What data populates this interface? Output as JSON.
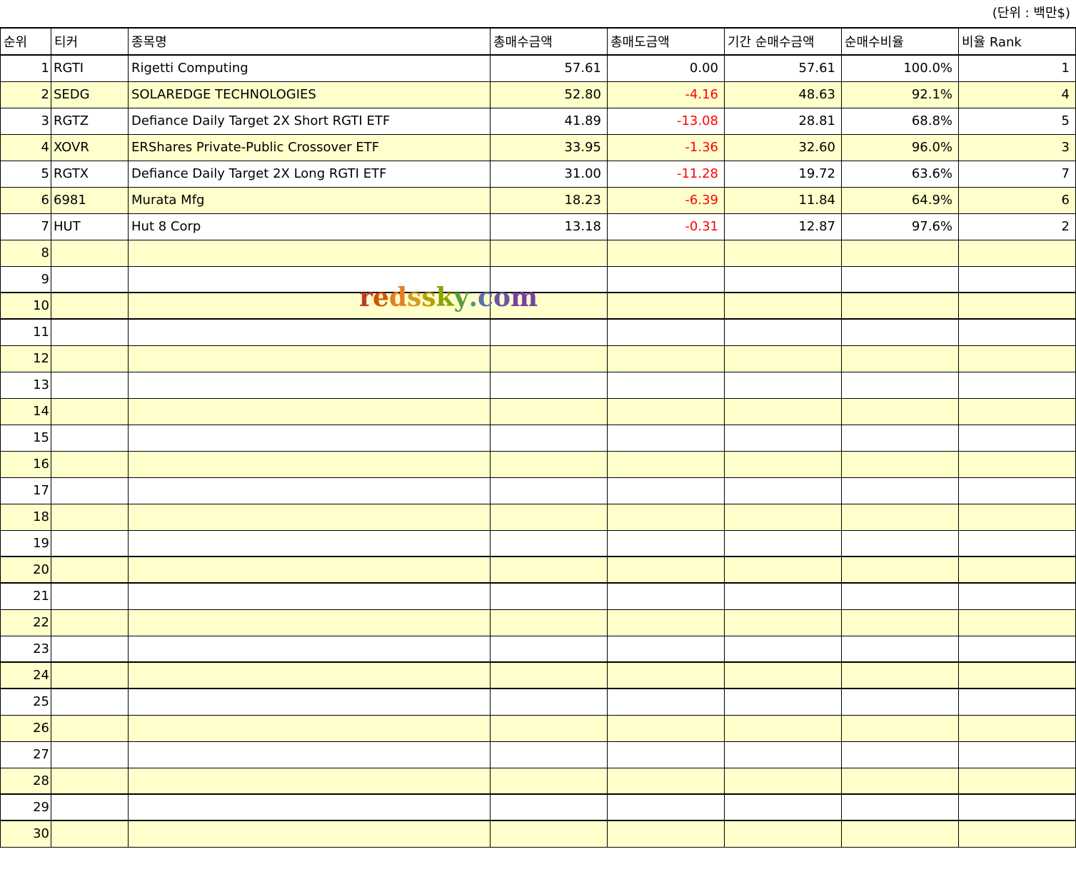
{
  "unit_label": "(단위 : 백만$)",
  "watermark": {
    "text": "redssky.com",
    "letters": [
      {
        "ch": "r",
        "color": "#c0392b"
      },
      {
        "ch": "e",
        "color": "#d35400"
      },
      {
        "ch": "d",
        "color": "#e67e22"
      },
      {
        "ch": "s",
        "color": "#d4a017"
      },
      {
        "ch": "s",
        "color": "#b8a200"
      },
      {
        "ch": "k",
        "color": "#8aa300"
      },
      {
        "ch": "y",
        "color": "#5a9e3a"
      },
      {
        "ch": ".",
        "color": "#4a9a7a"
      },
      {
        "ch": "c",
        "color": "#5b6fae"
      },
      {
        "ch": "o",
        "color": "#6a55a8"
      },
      {
        "ch": "m",
        "color": "#7b3fa0"
      }
    ]
  },
  "headers": [
    "순위",
    "티커",
    "종목명",
    "총매수금액",
    "총매도금액",
    "기간 순매수금액",
    "순매수비율",
    "비율 Rank"
  ],
  "rows": [
    {
      "rank": "1",
      "ticker": "RGTI",
      "name": "Rigetti Computing",
      "buy": "57.61",
      "sell": "0.00",
      "net": "57.61",
      "ratio": "100.0%",
      "ratio_rank": "1",
      "sell_negative": false
    },
    {
      "rank": "2",
      "ticker": "SEDG",
      "name": "SOLAREDGE TECHNOLOGIES",
      "buy": "52.80",
      "sell": "-4.16",
      "net": "48.63",
      "ratio": "92.1%",
      "ratio_rank": "4",
      "sell_negative": true
    },
    {
      "rank": "3",
      "ticker": "RGTZ",
      "name": "Defiance Daily Target 2X Short RGTI ETF",
      "buy": "41.89",
      "sell": "-13.08",
      "net": "28.81",
      "ratio": "68.8%",
      "ratio_rank": "5",
      "sell_negative": true
    },
    {
      "rank": "4",
      "ticker": "XOVR",
      "name": "ERShares Private-Public Crossover ETF",
      "buy": "33.95",
      "sell": "-1.36",
      "net": "32.60",
      "ratio": "96.0%",
      "ratio_rank": "3",
      "sell_negative": true
    },
    {
      "rank": "5",
      "ticker": "RGTX",
      "name": "Defiance Daily Target 2X Long RGTI ETF",
      "buy": "31.00",
      "sell": "-11.28",
      "net": "19.72",
      "ratio": "63.6%",
      "ratio_rank": "7",
      "sell_negative": true
    },
    {
      "rank": "6",
      "ticker": "6981",
      "name": "Murata Mfg",
      "buy": "18.23",
      "sell": "-6.39",
      "net": "11.84",
      "ratio": "64.9%",
      "ratio_rank": "6",
      "sell_negative": true
    },
    {
      "rank": "7",
      "ticker": "HUT",
      "name": "Hut 8 Corp",
      "buy": "13.18",
      "sell": "-0.31",
      "net": "12.87",
      "ratio": "97.6%",
      "ratio_rank": "2",
      "sell_negative": true
    },
    {
      "rank": "8",
      "ticker": "",
      "name": "",
      "buy": "",
      "sell": "",
      "net": "",
      "ratio": "",
      "ratio_rank": "",
      "sell_negative": false
    },
    {
      "rank": "9",
      "ticker": "",
      "name": "",
      "buy": "",
      "sell": "",
      "net": "",
      "ratio": "",
      "ratio_rank": "",
      "sell_negative": false
    },
    {
      "rank": "10",
      "ticker": "",
      "name": "",
      "buy": "",
      "sell": "",
      "net": "",
      "ratio": "",
      "ratio_rank": "",
      "sell_negative": false
    },
    {
      "rank": "11",
      "ticker": "",
      "name": "",
      "buy": "",
      "sell": "",
      "net": "",
      "ratio": "",
      "ratio_rank": "",
      "sell_negative": false
    },
    {
      "rank": "12",
      "ticker": "",
      "name": "",
      "buy": "",
      "sell": "",
      "net": "",
      "ratio": "",
      "ratio_rank": "",
      "sell_negative": false
    },
    {
      "rank": "13",
      "ticker": "",
      "name": "",
      "buy": "",
      "sell": "",
      "net": "",
      "ratio": "",
      "ratio_rank": "",
      "sell_negative": false
    },
    {
      "rank": "14",
      "ticker": "",
      "name": "",
      "buy": "",
      "sell": "",
      "net": "",
      "ratio": "",
      "ratio_rank": "",
      "sell_negative": false
    },
    {
      "rank": "15",
      "ticker": "",
      "name": "",
      "buy": "",
      "sell": "",
      "net": "",
      "ratio": "",
      "ratio_rank": "",
      "sell_negative": false
    },
    {
      "rank": "16",
      "ticker": "",
      "name": "",
      "buy": "",
      "sell": "",
      "net": "",
      "ratio": "",
      "ratio_rank": "",
      "sell_negative": false
    },
    {
      "rank": "17",
      "ticker": "",
      "name": "",
      "buy": "",
      "sell": "",
      "net": "",
      "ratio": "",
      "ratio_rank": "",
      "sell_negative": false
    },
    {
      "rank": "18",
      "ticker": "",
      "name": "",
      "buy": "",
      "sell": "",
      "net": "",
      "ratio": "",
      "ratio_rank": "",
      "sell_negative": false
    },
    {
      "rank": "19",
      "ticker": "",
      "name": "",
      "buy": "",
      "sell": "",
      "net": "",
      "ratio": "",
      "ratio_rank": "",
      "sell_negative": false
    },
    {
      "rank": "20",
      "ticker": "",
      "name": "",
      "buy": "",
      "sell": "",
      "net": "",
      "ratio": "",
      "ratio_rank": "",
      "sell_negative": false
    },
    {
      "rank": "21",
      "ticker": "",
      "name": "",
      "buy": "",
      "sell": "",
      "net": "",
      "ratio": "",
      "ratio_rank": "",
      "sell_negative": false
    },
    {
      "rank": "22",
      "ticker": "",
      "name": "",
      "buy": "",
      "sell": "",
      "net": "",
      "ratio": "",
      "ratio_rank": "",
      "sell_negative": false
    },
    {
      "rank": "23",
      "ticker": "",
      "name": "",
      "buy": "",
      "sell": "",
      "net": "",
      "ratio": "",
      "ratio_rank": "",
      "sell_negative": false
    },
    {
      "rank": "24",
      "ticker": "",
      "name": "",
      "buy": "",
      "sell": "",
      "net": "",
      "ratio": "",
      "ratio_rank": "",
      "sell_negative": false
    },
    {
      "rank": "25",
      "ticker": "",
      "name": "",
      "buy": "",
      "sell": "",
      "net": "",
      "ratio": "",
      "ratio_rank": "",
      "sell_negative": false
    },
    {
      "rank": "26",
      "ticker": "",
      "name": "",
      "buy": "",
      "sell": "",
      "net": "",
      "ratio": "",
      "ratio_rank": "",
      "sell_negative": false
    },
    {
      "rank": "27",
      "ticker": "",
      "name": "",
      "buy": "",
      "sell": "",
      "net": "",
      "ratio": "",
      "ratio_rank": "",
      "sell_negative": false
    },
    {
      "rank": "28",
      "ticker": "",
      "name": "",
      "buy": "",
      "sell": "",
      "net": "",
      "ratio": "",
      "ratio_rank": "",
      "sell_negative": false
    },
    {
      "rank": "29",
      "ticker": "",
      "name": "",
      "buy": "",
      "sell": "",
      "net": "",
      "ratio": "",
      "ratio_rank": "",
      "sell_negative": false
    },
    {
      "rank": "30",
      "ticker": "",
      "name": "",
      "buy": "",
      "sell": "",
      "net": "",
      "ratio": "",
      "ratio_rank": "",
      "sell_negative": false
    }
  ],
  "colors": {
    "stripe": "#ffffcc",
    "negative": "#ff0000"
  }
}
